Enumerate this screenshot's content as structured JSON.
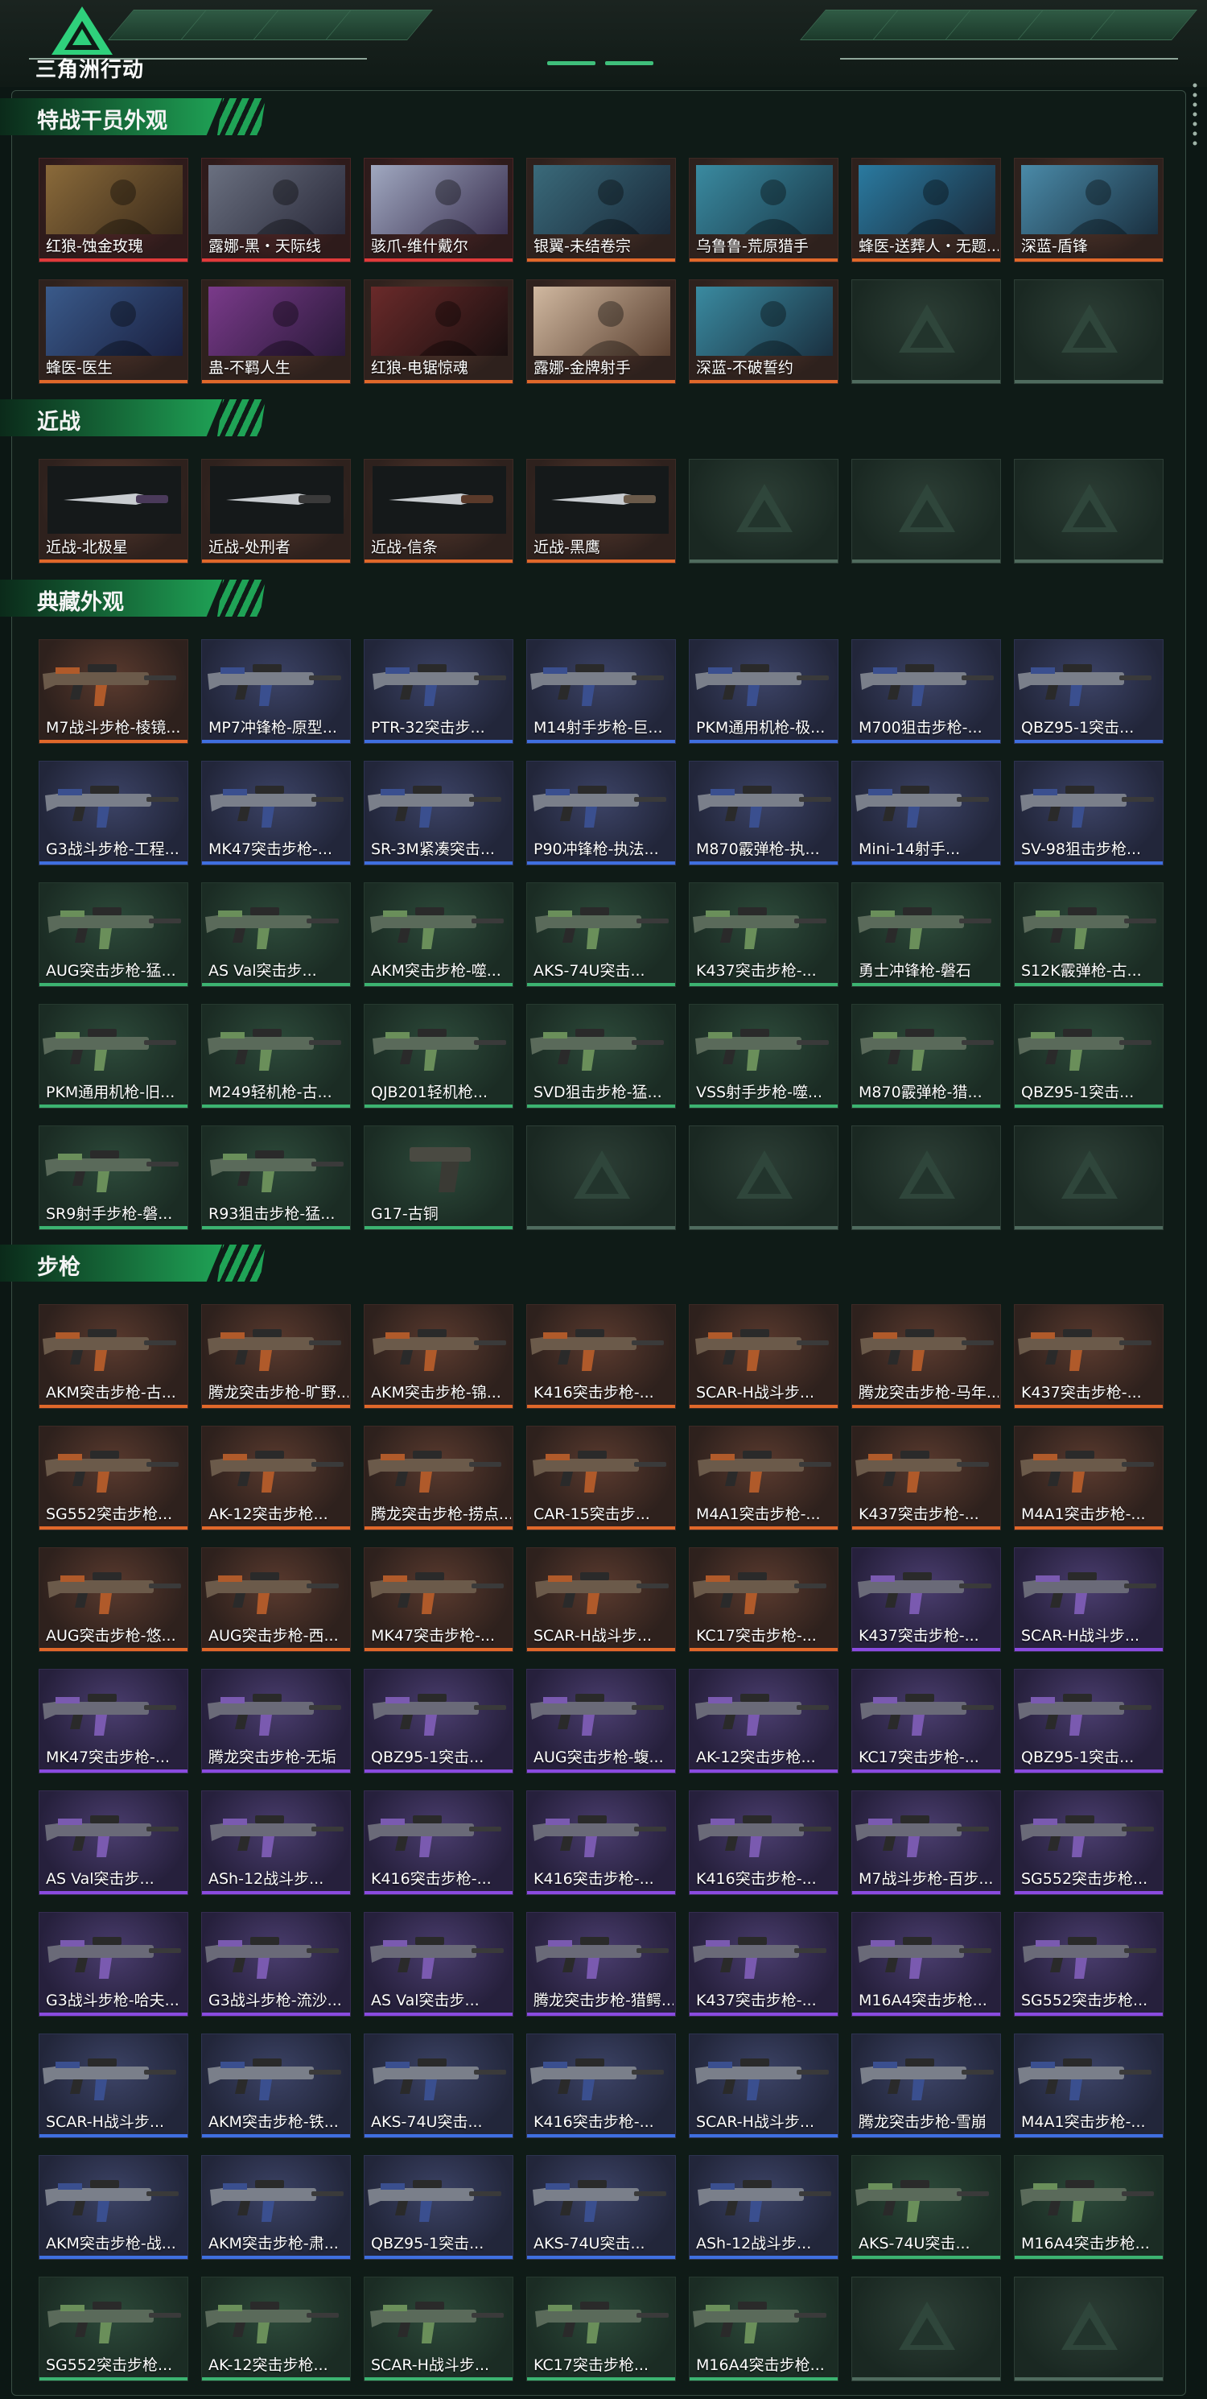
{
  "header": {
    "logo_text": "三角洲行动"
  },
  "colors": {
    "orange": "#e0682a",
    "blue": "#3f6fe0",
    "purple": "#8a4be0",
    "green": "#3cb371",
    "gold": "#d4a22a",
    "red": "#e03a3a"
  },
  "sections": [
    {
      "title": "特战干员外观",
      "items": [
        {
          "label": "红狼-蚀金玫瑰",
          "rarity": "red",
          "kind": "operator"
        },
        {
          "label": "露娜-黑・天际线",
          "rarity": "red",
          "kind": "operator"
        },
        {
          "label": "骇爪-维什戴尔",
          "rarity": "red",
          "kind": "operator"
        },
        {
          "label": "银翼-未结卷宗",
          "rarity": "orange",
          "kind": "operator"
        },
        {
          "label": "乌鲁鲁-荒原猎手",
          "rarity": "orange",
          "kind": "operator"
        },
        {
          "label": "蜂医-送葬人・无题...",
          "rarity": "orange",
          "kind": "operator"
        },
        {
          "label": "深蓝-盾锋",
          "rarity": "orange",
          "kind": "operator"
        },
        {
          "label": "蜂医-医生",
          "rarity": "orange",
          "kind": "operator"
        },
        {
          "label": "蛊-不羁人生",
          "rarity": "orange",
          "kind": "operator"
        },
        {
          "label": "红狼-电锯惊魂",
          "rarity": "orange",
          "kind": "operator"
        },
        {
          "label": "露娜-金牌射手",
          "rarity": "orange",
          "kind": "operator"
        },
        {
          "label": "深蓝-不破誓约",
          "rarity": "orange",
          "kind": "operator"
        },
        {
          "label": "",
          "rarity": "none",
          "kind": "empty"
        },
        {
          "label": "",
          "rarity": "none",
          "kind": "empty"
        }
      ]
    },
    {
      "title": "近战",
      "items": [
        {
          "label": "近战-北极星",
          "rarity": "orange",
          "kind": "melee"
        },
        {
          "label": "近战-处刑者",
          "rarity": "orange",
          "kind": "melee"
        },
        {
          "label": "近战-信条",
          "rarity": "orange",
          "kind": "melee"
        },
        {
          "label": "近战-黑鹰",
          "rarity": "orange",
          "kind": "melee"
        },
        {
          "label": "",
          "rarity": "none",
          "kind": "empty"
        },
        {
          "label": "",
          "rarity": "none",
          "kind": "empty"
        },
        {
          "label": "",
          "rarity": "none",
          "kind": "empty"
        }
      ]
    },
    {
      "title": "典藏外观",
      "items": [
        {
          "label": "M7战斗步枪-棱镜...",
          "rarity": "orange",
          "kind": "gun"
        },
        {
          "label": "MP7冲锋枪-原型...",
          "rarity": "blue",
          "kind": "gun"
        },
        {
          "label": "PTR-32突击步...",
          "rarity": "blue",
          "kind": "gun"
        },
        {
          "label": "M14射手步枪-巨...",
          "rarity": "blue",
          "kind": "gun"
        },
        {
          "label": "PKM通用机枪-极...",
          "rarity": "blue",
          "kind": "gun"
        },
        {
          "label": "M700狙击步枪-...",
          "rarity": "blue",
          "kind": "gun"
        },
        {
          "label": "QBZ95-1突击...",
          "rarity": "blue",
          "kind": "gun"
        },
        {
          "label": "G3战斗步枪-工程...",
          "rarity": "blue",
          "kind": "gun"
        },
        {
          "label": "MK47突击步枪-...",
          "rarity": "blue",
          "kind": "gun"
        },
        {
          "label": "SR-3M紧凑突击...",
          "rarity": "blue",
          "kind": "gun"
        },
        {
          "label": "P90冲锋枪-执法...",
          "rarity": "blue",
          "kind": "gun"
        },
        {
          "label": "M870霰弹枪-执...",
          "rarity": "blue",
          "kind": "gun"
        },
        {
          "label": "Mini-14射手...",
          "rarity": "blue",
          "kind": "gun"
        },
        {
          "label": "SV-98狙击步枪...",
          "rarity": "blue",
          "kind": "gun"
        },
        {
          "label": "AUG突击步枪-猛...",
          "rarity": "green",
          "kind": "gun"
        },
        {
          "label": "AS Val突击步...",
          "rarity": "green",
          "kind": "gun"
        },
        {
          "label": "AKM突击步枪-噬...",
          "rarity": "green",
          "kind": "gun"
        },
        {
          "label": "AKS-74U突击...",
          "rarity": "green",
          "kind": "gun"
        },
        {
          "label": "K437突击步枪-...",
          "rarity": "green",
          "kind": "gun"
        },
        {
          "label": "勇士冲锋枪-磐石",
          "rarity": "green",
          "kind": "gun"
        },
        {
          "label": "S12K霰弹枪-古...",
          "rarity": "green",
          "kind": "gun"
        },
        {
          "label": "PKM通用机枪-旧...",
          "rarity": "green",
          "kind": "gun"
        },
        {
          "label": "M249轻机枪-古...",
          "rarity": "green",
          "kind": "gun"
        },
        {
          "label": "QJB201轻机枪...",
          "rarity": "green",
          "kind": "gun"
        },
        {
          "label": "SVD狙击步枪-猛...",
          "rarity": "green",
          "kind": "gun"
        },
        {
          "label": "VSS射手步枪-噬...",
          "rarity": "green",
          "kind": "gun"
        },
        {
          "label": "M870霰弹枪-猎...",
          "rarity": "green",
          "kind": "gun"
        },
        {
          "label": "QBZ95-1突击...",
          "rarity": "green",
          "kind": "gun"
        },
        {
          "label": "SR9射手步枪-磐...",
          "rarity": "green",
          "kind": "gun"
        },
        {
          "label": "R93狙击步枪-猛...",
          "rarity": "green",
          "kind": "gun"
        },
        {
          "label": "G17-古铜",
          "rarity": "green",
          "kind": "pistol"
        },
        {
          "label": "",
          "rarity": "none",
          "kind": "empty"
        },
        {
          "label": "",
          "rarity": "none",
          "kind": "empty"
        },
        {
          "label": "",
          "rarity": "none",
          "kind": "empty"
        },
        {
          "label": "",
          "rarity": "none",
          "kind": "empty"
        }
      ]
    },
    {
      "title": "步枪",
      "items": [
        {
          "label": "AKM突击步枪-古...",
          "rarity": "orange",
          "kind": "gun"
        },
        {
          "label": "腾龙突击步枪-旷野...",
          "rarity": "orange",
          "kind": "gun"
        },
        {
          "label": "AKM突击步枪-锦...",
          "rarity": "orange",
          "kind": "gun"
        },
        {
          "label": "K416突击步枪-...",
          "rarity": "orange",
          "kind": "gun"
        },
        {
          "label": "SCAR-H战斗步...",
          "rarity": "orange",
          "kind": "gun"
        },
        {
          "label": "腾龙突击步枪-马年...",
          "rarity": "orange",
          "kind": "gun"
        },
        {
          "label": "K437突击步枪-...",
          "rarity": "orange",
          "kind": "gun"
        },
        {
          "label": "SG552突击步枪...",
          "rarity": "orange",
          "kind": "gun"
        },
        {
          "label": "AK-12突击步枪...",
          "rarity": "orange",
          "kind": "gun"
        },
        {
          "label": "腾龙突击步枪-捞点...",
          "rarity": "orange",
          "kind": "gun"
        },
        {
          "label": "CAR-15突击步...",
          "rarity": "orange",
          "kind": "gun"
        },
        {
          "label": "M4A1突击步枪-...",
          "rarity": "orange",
          "kind": "gun"
        },
        {
          "label": "K437突击步枪-...",
          "rarity": "orange",
          "kind": "gun"
        },
        {
          "label": "M4A1突击步枪-...",
          "rarity": "orange",
          "kind": "gun"
        },
        {
          "label": "AUG突击步枪-悠...",
          "rarity": "orange",
          "kind": "gun"
        },
        {
          "label": "AUG突击步枪-西...",
          "rarity": "orange",
          "kind": "gun"
        },
        {
          "label": "MK47突击步枪-...",
          "rarity": "orange",
          "kind": "gun"
        },
        {
          "label": "SCAR-H战斗步...",
          "rarity": "orange",
          "kind": "gun"
        },
        {
          "label": "KC17突击步枪-...",
          "rarity": "orange",
          "kind": "gun"
        },
        {
          "label": "K437突击步枪-...",
          "rarity": "purple",
          "kind": "gun"
        },
        {
          "label": "SCAR-H战斗步...",
          "rarity": "purple",
          "kind": "gun"
        },
        {
          "label": "MK47突击步枪-...",
          "rarity": "purple",
          "kind": "gun"
        },
        {
          "label": "腾龙突击步枪-无垢",
          "rarity": "purple",
          "kind": "gun"
        },
        {
          "label": "QBZ95-1突击...",
          "rarity": "purple",
          "kind": "gun"
        },
        {
          "label": "AUG突击步枪-蝮...",
          "rarity": "purple",
          "kind": "gun"
        },
        {
          "label": "AK-12突击步枪...",
          "rarity": "purple",
          "kind": "gun"
        },
        {
          "label": "KC17突击步枪-...",
          "rarity": "purple",
          "kind": "gun"
        },
        {
          "label": "QBZ95-1突击...",
          "rarity": "purple",
          "kind": "gun"
        },
        {
          "label": "AS Val突击步...",
          "rarity": "purple",
          "kind": "gun"
        },
        {
          "label": "ASh-12战斗步...",
          "rarity": "purple",
          "kind": "gun"
        },
        {
          "label": "K416突击步枪-...",
          "rarity": "purple",
          "kind": "gun"
        },
        {
          "label": "K416突击步枪-...",
          "rarity": "purple",
          "kind": "gun"
        },
        {
          "label": "K416突击步枪-...",
          "rarity": "purple",
          "kind": "gun"
        },
        {
          "label": "M7战斗步枪-百步...",
          "rarity": "purple",
          "kind": "gun"
        },
        {
          "label": "SG552突击步枪...",
          "rarity": "purple",
          "kind": "gun"
        },
        {
          "label": "G3战斗步枪-哈夫...",
          "rarity": "purple",
          "kind": "gun"
        },
        {
          "label": "G3战斗步枪-流沙...",
          "rarity": "purple",
          "kind": "gun"
        },
        {
          "label": "AS Val突击步...",
          "rarity": "purple",
          "kind": "gun"
        },
        {
          "label": "腾龙突击步枪-猎鳄...",
          "rarity": "purple",
          "kind": "gun"
        },
        {
          "label": "K437突击步枪-...",
          "rarity": "purple",
          "kind": "gun"
        },
        {
          "label": "M16A4突击步枪...",
          "rarity": "purple",
          "kind": "gun"
        },
        {
          "label": "SG552突击步枪...",
          "rarity": "purple",
          "kind": "gun"
        },
        {
          "label": "SCAR-H战斗步...",
          "rarity": "blue",
          "kind": "gun"
        },
        {
          "label": "AKM突击步枪-铁...",
          "rarity": "blue",
          "kind": "gun"
        },
        {
          "label": "AKS-74U突击...",
          "rarity": "blue",
          "kind": "gun"
        },
        {
          "label": "K416突击步枪-...",
          "rarity": "blue",
          "kind": "gun"
        },
        {
          "label": "SCAR-H战斗步...",
          "rarity": "blue",
          "kind": "gun"
        },
        {
          "label": "腾龙突击步枪-雪崩",
          "rarity": "blue",
          "kind": "gun"
        },
        {
          "label": "M4A1突击步枪-...",
          "rarity": "blue",
          "kind": "gun"
        },
        {
          "label": "AKM突击步枪-战...",
          "rarity": "blue",
          "kind": "gun"
        },
        {
          "label": "AKM突击步枪-肃...",
          "rarity": "blue",
          "kind": "gun"
        },
        {
          "label": "QBZ95-1突击...",
          "rarity": "blue",
          "kind": "gun"
        },
        {
          "label": "AKS-74U突击...",
          "rarity": "blue",
          "kind": "gun"
        },
        {
          "label": "ASh-12战斗步...",
          "rarity": "blue",
          "kind": "gun"
        },
        {
          "label": "AKS-74U突击...",
          "rarity": "green",
          "kind": "gun"
        },
        {
          "label": "M16A4突击步枪...",
          "rarity": "green",
          "kind": "gun"
        },
        {
          "label": "SG552突击步枪...",
          "rarity": "green",
          "kind": "gun"
        },
        {
          "label": "AK-12突击步枪...",
          "rarity": "green",
          "kind": "gun"
        },
        {
          "label": "SCAR-H战斗步...",
          "rarity": "green",
          "kind": "gun"
        },
        {
          "label": "KC17突击步枪...",
          "rarity": "green",
          "kind": "gun"
        },
        {
          "label": "M16A4突击步枪...",
          "rarity": "green",
          "kind": "gun"
        },
        {
          "label": "",
          "rarity": "none",
          "kind": "empty"
        },
        {
          "label": "",
          "rarity": "none",
          "kind": "empty"
        }
      ]
    }
  ]
}
